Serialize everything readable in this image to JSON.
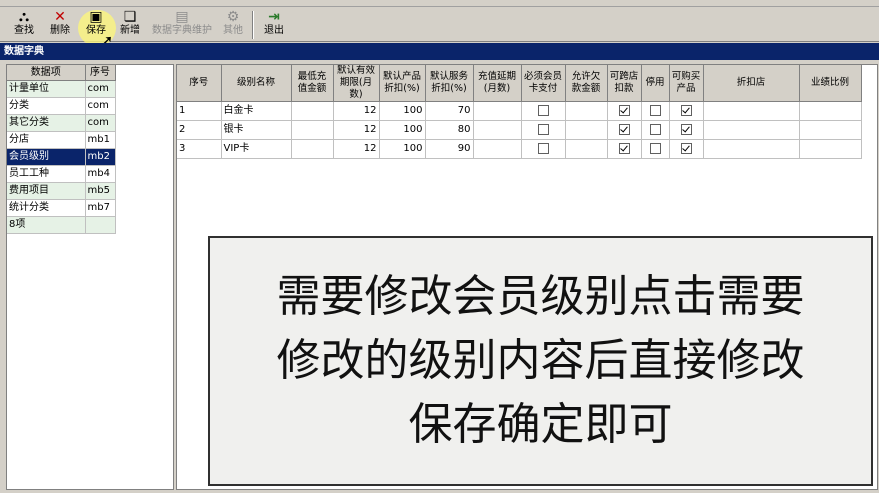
{
  "toolbar": {
    "find": "查找",
    "delete": "删除",
    "save": "保存",
    "new": "新增",
    "dict_maintain": "数据字典维护",
    "other": "其他",
    "exit": "退出"
  },
  "window_title": "数据字典",
  "left_table": {
    "headers": [
      "数据项",
      "序号"
    ],
    "rows": [
      [
        "计量单位",
        "com"
      ],
      [
        "分类",
        "com"
      ],
      [
        "其它分类",
        "com"
      ],
      [
        "分店",
        "mb1"
      ],
      [
        "会员级别",
        "mb2"
      ],
      [
        "员工工种",
        "mb4"
      ],
      [
        "费用项目",
        "mb5"
      ],
      [
        "统计分类",
        "mb7"
      ],
      [
        "8项",
        ""
      ]
    ],
    "selected_index": 4
  },
  "right_table": {
    "headers": [
      "序号",
      "级别名称",
      "最低充值金额",
      "默认有效期限(月数)",
      "默认产品折扣(%)",
      "默认服务折扣(%)",
      "充值延期(月数)",
      "必须会员卡支付",
      "允许欠款金额",
      "可跨店扣款",
      "停用",
      "可购买产品",
      "折扣店",
      "业绩比例"
    ],
    "rows": [
      {
        "no": "1",
        "name": "白金卡",
        "min": "",
        "months": "12",
        "prod": "100",
        "serv": "70",
        "ext": "",
        "must": false,
        "owe": "",
        "cross": true,
        "stop": false,
        "buy": true,
        "shop": "",
        "ratio": ""
      },
      {
        "no": "2",
        "name": "银卡",
        "min": "",
        "months": "12",
        "prod": "100",
        "serv": "80",
        "ext": "",
        "must": false,
        "owe": "",
        "cross": true,
        "stop": false,
        "buy": true,
        "shop": "",
        "ratio": ""
      },
      {
        "no": "3",
        "name": "VIP卡",
        "min": "",
        "months": "12",
        "prod": "100",
        "serv": "90",
        "ext": "",
        "must": false,
        "owe": "",
        "cross": true,
        "stop": false,
        "buy": true,
        "shop": "",
        "ratio": ""
      }
    ]
  },
  "overlay": {
    "line1": "需要修改会员级别点击需要",
    "line2": "修改的级别内容后直接修改",
    "line3": "保存确定即可"
  }
}
